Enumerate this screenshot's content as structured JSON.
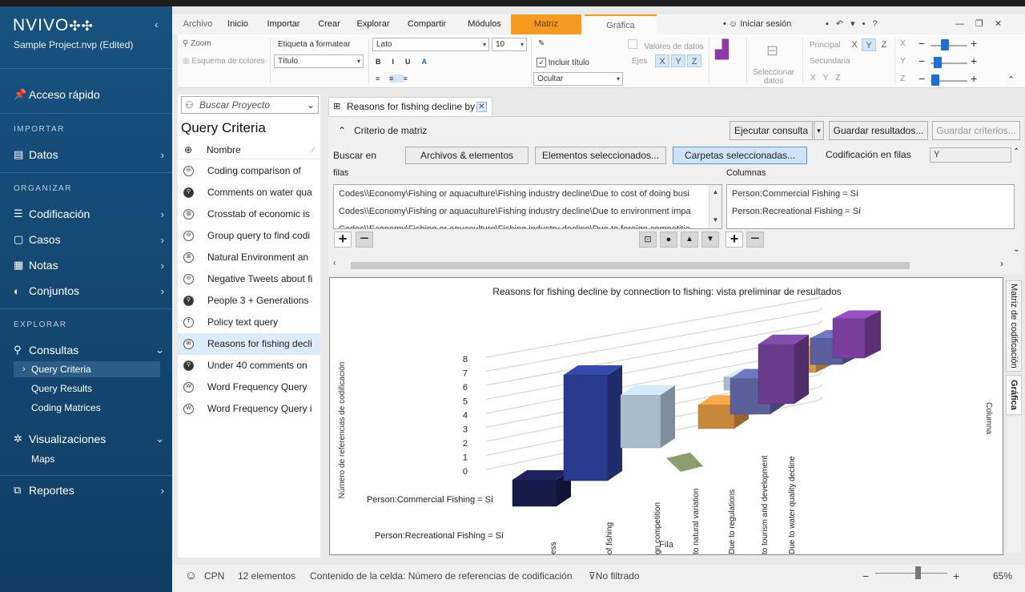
{
  "app": {
    "brand": "NVIVO",
    "brand_mark": "✣✣",
    "project": "Sample Project.nvp (Edited)"
  },
  "sidebar": {
    "quick_access": "Acceso rápido",
    "sections": {
      "importar": "IMPORTAR",
      "organizar": "ORGANIZAR",
      "explorar": "EXPLORAR"
    },
    "items": {
      "datos": "Datos",
      "codificacion": "Codificación",
      "casos": "Casos",
      "notas": "Notas",
      "conjuntos": "Conjuntos",
      "consultas": "Consultas",
      "visualizaciones": "Visualizaciones",
      "reportes": "Reportes"
    },
    "consultas_sub": [
      "Query Criteria",
      "Query Results",
      "Coding Matrices"
    ],
    "visualizaciones_sub": [
      "Maps"
    ]
  },
  "ribbon": {
    "tabs": [
      "Archivo",
      "Inicio",
      "Importar",
      "Crear",
      "Explorar",
      "Compartir",
      "Módulos",
      "Matriz",
      "Gráfica"
    ],
    "signin": "Iniciar sesión",
    "zoom": "Zoom",
    "color_scheme": "Esquema de colores",
    "label_format": "Etiqueta a formatear",
    "label_value": "Título",
    "font": "Lato",
    "font_size": "10",
    "data_values": "Valores de datos",
    "include_title": "Incluir título",
    "axes": "Ejes",
    "hide": "Ocultar",
    "select_data": "Seleccionar datos",
    "principal": "Principal",
    "secundaria": "Secundaria",
    "axis_x": "X",
    "axis_y": "Y",
    "axis_z": "Z"
  },
  "project_panel": {
    "search_placeholder": "Buscar Proyecto",
    "title": "Query Criteria",
    "column": "Nombre",
    "queries": [
      {
        "name": "Coding comparison of",
        "icon": "coding"
      },
      {
        "name": "Comments on water qua",
        "icon": "text"
      },
      {
        "name": "Crosstab of economic is",
        "icon": "crosstab"
      },
      {
        "name": "Group query to find codi",
        "icon": "group"
      },
      {
        "name": "Natural Environment an",
        "icon": "matrix"
      },
      {
        "name": "Negative Tweets about fi",
        "icon": "group"
      },
      {
        "name": "People 3 + Generations",
        "icon": "text"
      },
      {
        "name": "Policy text query",
        "icon": "text-t"
      },
      {
        "name": "Reasons for fishing decli",
        "icon": "matrix"
      },
      {
        "name": "Under 40 comments on",
        "icon": "text"
      },
      {
        "name": "Word Frequency Query",
        "icon": "word"
      },
      {
        "name": "Word Frequency Query i",
        "icon": "word"
      }
    ]
  },
  "document": {
    "tab_title": "Reasons for fishing decline by c",
    "criteria_header": "Criterio de matriz",
    "run_query": "Ejecutar consulta",
    "save_results": "Guardar resultados...",
    "save_criteria": "Guardar criterios...",
    "search_in": "Buscar en",
    "scope_buttons": [
      "Archivos & elementos",
      "Elementos seleccionados...",
      "Carpetas seleccionadas..."
    ],
    "row_coding": "Codificación en filas",
    "row_coding_value": "Y",
    "rows_label": "filas",
    "columns_label": "Columnas",
    "rows": [
      "Codes\\\\Economy\\Fishing or aquaculture\\Fishing industry decline\\Due to cost of doing busi",
      "Codes\\\\Economy\\Fishing or aquaculture\\Fishing industry decline\\Due to environment impa",
      "Codes\\\\Economy\\Fishing or aquaculture\\Fishing industry decline\\Due to foreign competitio"
    ],
    "columns": [
      "Person:Commercial Fishing = Sí",
      "Person:Recreational Fishing = Sí"
    ]
  },
  "chart_data": {
    "type": "bar",
    "title": "Reasons for fishing decline by connection to fishing: vista preliminar de resultados",
    "ylabel": "Número de referencias de codificación",
    "xlabel": "Fila",
    "zlabel": "Columna",
    "yticks": [
      "0",
      "1",
      "2",
      "3",
      "4",
      "5",
      "6",
      "7",
      "8"
    ],
    "ylim": [
      0,
      8
    ],
    "categories": [
      "ess",
      "of fishing",
      "gn competition",
      "to natural variation",
      "Due to regulations",
      "to tourism and development",
      "Due to water quality decline"
    ],
    "series": [
      {
        "name": "Person:Commercial Fishing = Sí",
        "values": [
          2,
          8,
          4,
          1,
          2,
          3,
          5
        ]
      },
      {
        "name": "Person:Recreational Fishing = Sí",
        "values": [
          0,
          0,
          1,
          0,
          2,
          2,
          3
        ]
      }
    ]
  },
  "side_tabs": {
    "matrix": "Matriz de codificación",
    "chart": "Gráfica"
  },
  "status": {
    "user": "CPN",
    "elements": "12 elementos",
    "cell_content": "Contenido de la celda: Número de referencias de codificación",
    "filter": "No filtrado",
    "zoom": "65%"
  }
}
